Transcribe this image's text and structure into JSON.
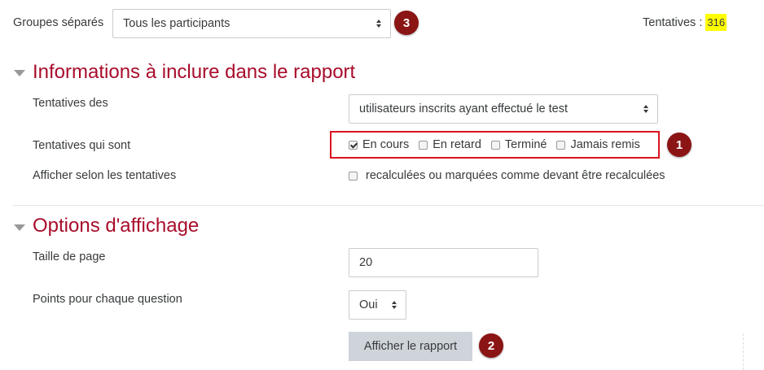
{
  "header": {
    "group_label": "Groupes séparés",
    "group_select_value": "Tous les participants",
    "attempts_label": "Tentatives : ",
    "attempts_count": "316",
    "highlight_color": "#ffff00"
  },
  "badges": {
    "one": "1",
    "two": "2",
    "three": "3",
    "badge_color": "#8b1414"
  },
  "section_report": {
    "title": "Informations à inclure dans le rapport",
    "attempts_from_label": "Tentatives des",
    "attempts_from_value": "utilisateurs inscrits ayant effectué le test",
    "attempts_state_label": "Tentatives qui sont",
    "states": [
      {
        "label": "En cours",
        "checked": true
      },
      {
        "label": "En retard",
        "checked": false
      },
      {
        "label": "Terminé",
        "checked": false
      },
      {
        "label": "Jamais remis",
        "checked": false
      }
    ],
    "regrade_label": "Afficher selon les tentatives",
    "regrade_option": "recalculées ou marquées comme devant être recalculées"
  },
  "section_display": {
    "title": "Options d'affichage",
    "page_size_label": "Taille de page",
    "page_size_value": "20",
    "marks_label": "Points pour chaque question",
    "marks_value": "Oui",
    "submit_label": "Afficher le rapport"
  },
  "colors": {
    "accent": "#a80d2b",
    "highlight_box": "#d9131f"
  }
}
